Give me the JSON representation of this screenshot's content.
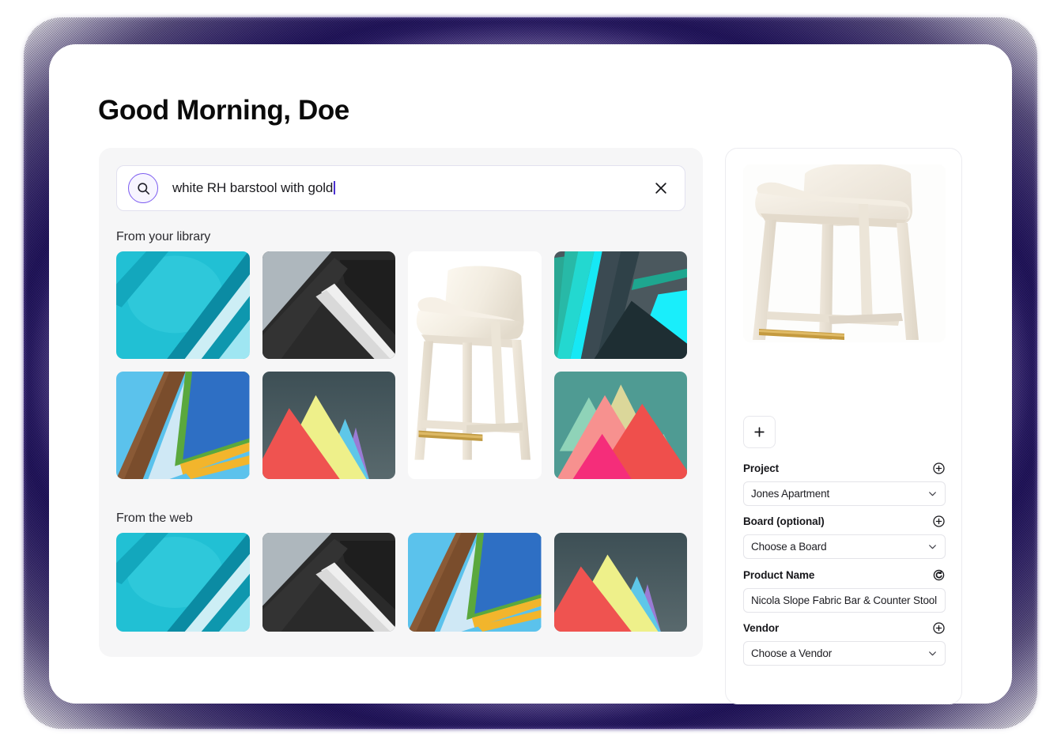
{
  "page": {
    "title": "Good Morning, Doe"
  },
  "search": {
    "icon": "search-icon",
    "value": "white RH barstool with gold",
    "clear_icon": "close-icon"
  },
  "sections": {
    "library_label": "From your library",
    "web_label": "From the web"
  },
  "library_thumbs": [
    {
      "name": "abstract-cyan-diagonal",
      "kind": "abstract-cyan"
    },
    {
      "name": "abstract-gray-black-diagonal",
      "kind": "abstract-gray"
    },
    {
      "name": "barstool-product-photo",
      "kind": "barstool"
    },
    {
      "name": "abstract-teal-geometric",
      "kind": "abstract-teal"
    },
    {
      "name": "abstract-blue-brown-stripes",
      "kind": "abstract-blue"
    },
    {
      "name": "abstract-mountains-dark",
      "kind": "mountains-dark"
    },
    {
      "name": "abstract-mountains-pink",
      "kind": "mountains-pink"
    }
  ],
  "web_thumbs": [
    {
      "name": "abstract-cyan-diagonal",
      "kind": "abstract-cyan"
    },
    {
      "name": "abstract-gray-black-diagonal",
      "kind": "abstract-gray"
    },
    {
      "name": "abstract-blue-brown-stripes",
      "kind": "abstract-blue"
    },
    {
      "name": "abstract-mountains-dark",
      "kind": "mountains-dark"
    }
  ],
  "detail": {
    "hero_alt": "barstool-detail-photo",
    "add_image_label": "+",
    "fields": [
      {
        "label": "Project",
        "value": "Jones Apartment",
        "action_icon": "plus-circle-icon",
        "control": "select"
      },
      {
        "label": "Board (optional)",
        "value": "Choose a Board",
        "action_icon": "plus-circle-icon",
        "control": "select"
      },
      {
        "label": "Product Name",
        "value": "Nicola Slope Fabric Bar & Counter Stool | F",
        "action_icon": "search-refresh-icon",
        "control": "text"
      },
      {
        "label": "Vendor",
        "value": "Choose a Vendor",
        "action_icon": "plus-circle-icon",
        "control": "select"
      }
    ]
  },
  "colors": {
    "accent": "#7c5cf0",
    "panel_bg": "#f6f6f7",
    "card_bg": "#ffffff",
    "glow": "#2d1678",
    "text": "#0a0a0a"
  }
}
